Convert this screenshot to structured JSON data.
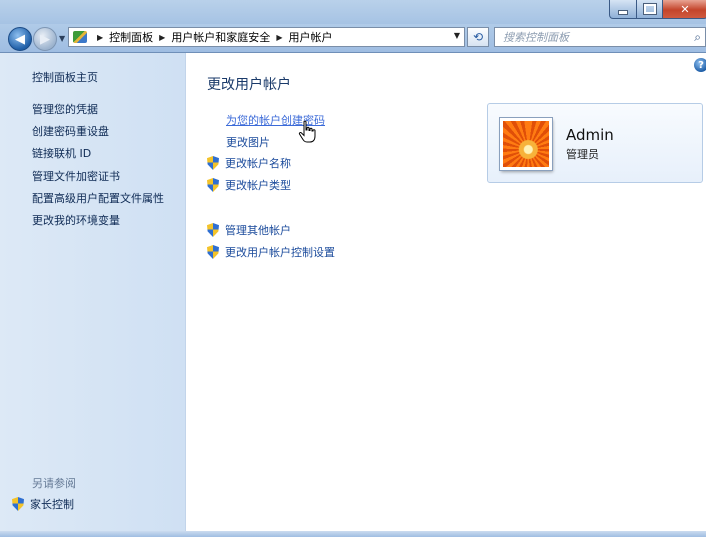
{
  "window": {
    "minimize_glyph": "",
    "maximize_glyph": "",
    "close_glyph": "✕"
  },
  "nav": {
    "back_glyph": "◀",
    "forward_glyph": "▶",
    "breadcrumbs": [
      "控制面板",
      "用户帐户和家庭安全",
      "用户帐户"
    ],
    "search_placeholder": "搜索控制面板"
  },
  "sidebar": {
    "home": "控制面板主页",
    "items": [
      "管理您的凭据",
      "创建密码重设盘",
      "链接联机 ID",
      "管理文件加密证书",
      "配置高级用户配置文件属性",
      "更改我的环境变量"
    ],
    "see_also_title": "另请参阅",
    "see_also_items": [
      "家长控制"
    ]
  },
  "main": {
    "title": "更改用户帐户",
    "tasks": [
      {
        "label": "为您的帐户创建密码",
        "shield": false
      },
      {
        "label": "更改图片",
        "shield": false
      },
      {
        "label": "更改帐户名称",
        "shield": true
      },
      {
        "label": "更改帐户类型",
        "shield": true
      }
    ],
    "other_tasks": [
      {
        "label": "管理其他帐户",
        "shield": true
      },
      {
        "label": "更改用户帐户控制设置",
        "shield": true
      }
    ],
    "help_glyph": "?"
  },
  "user": {
    "name": "Admin",
    "role": "管理员"
  }
}
